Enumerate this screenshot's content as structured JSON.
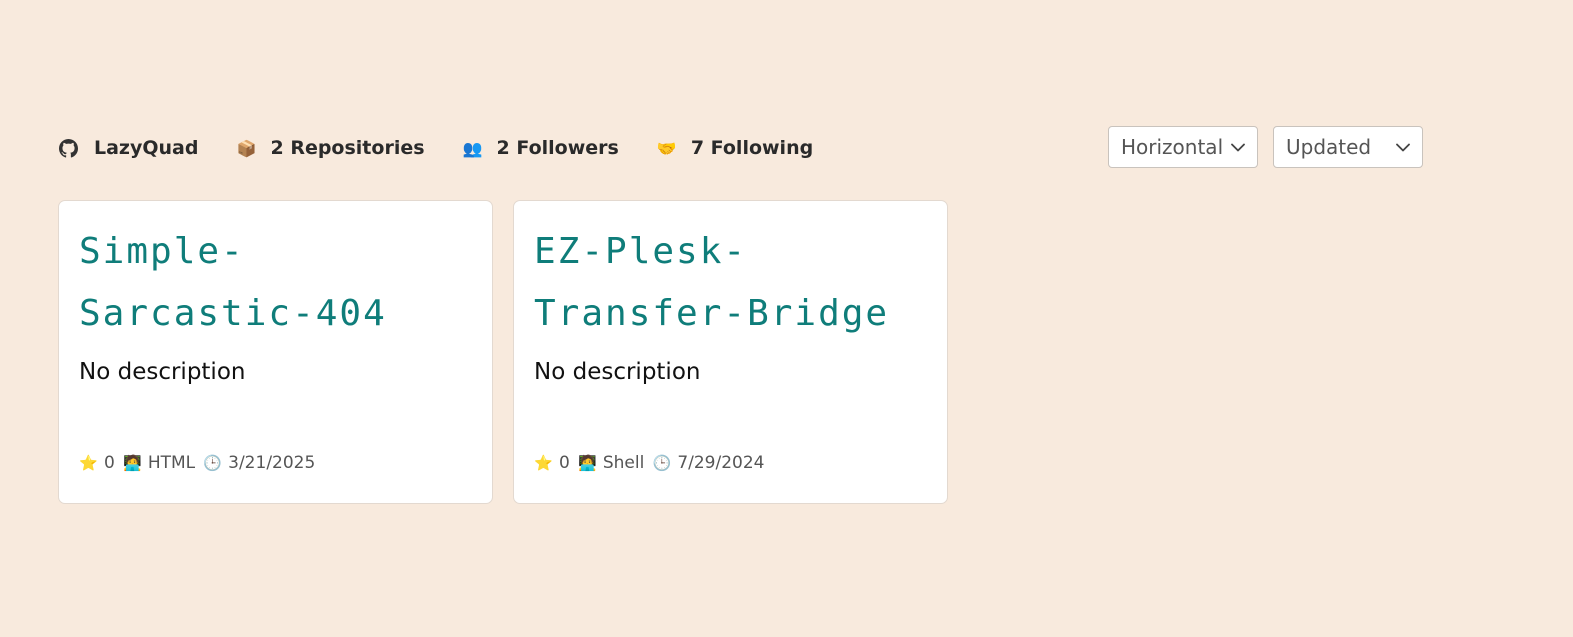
{
  "profile": {
    "username": "LazyQuad",
    "repositories": "2 Repositories",
    "followers": "2 Followers",
    "following": "7 Following"
  },
  "icons": {
    "user": "github-icon",
    "repositories": "package-icon",
    "followers": "people-icon",
    "following": "handshake-icon",
    "stars": "star-icon",
    "language": "developer-icon",
    "updated": "clock-icon"
  },
  "controls": {
    "layout_select": "Horizontal",
    "sort_select": "Updated"
  },
  "repos": [
    {
      "name": "Simple-Sarcastic-404",
      "description": "No description",
      "stars": "0",
      "language": "HTML",
      "updated": "3/21/2025"
    },
    {
      "name": "EZ-Plesk-Transfer-Bridge",
      "description": "No description",
      "stars": "0",
      "language": "Shell",
      "updated": "7/29/2024"
    }
  ],
  "colors": {
    "background": "#f8eadd",
    "repo_title": "#0f7d7a",
    "card": "#ffffff"
  }
}
